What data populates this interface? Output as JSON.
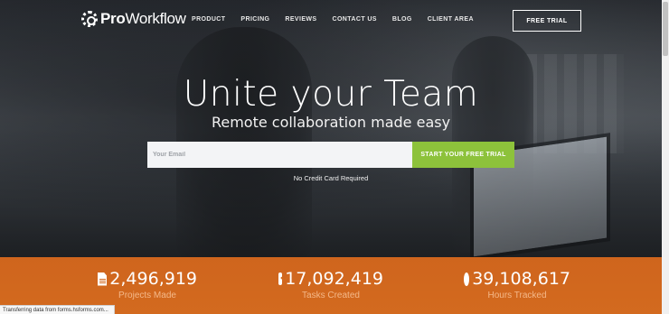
{
  "brand": {
    "logo_bold": "Pro",
    "logo_light": "Workflow"
  },
  "nav": {
    "items": [
      "PRODUCT",
      "PRICING",
      "REVIEWS",
      "CONTACT US",
      "BLOG",
      "CLIENT AREA"
    ],
    "cta": "FREE TRIAL"
  },
  "hero": {
    "title": "Unite your Team",
    "subtitle": "Remote collaboration made easy",
    "email_placeholder": "Your Email",
    "submit_label": "START YOUR FREE TRIAL",
    "note": "No Credit Card Required"
  },
  "stats": [
    {
      "icon": "document-icon",
      "value": "2,496,919",
      "label": "Projects Made"
    },
    {
      "icon": "checkbox-icon",
      "value": "17,092,419",
      "label": "Tasks Created"
    },
    {
      "icon": "clock-icon",
      "value": "39,108,617",
      "label": "Hours Tracked"
    }
  ],
  "status_bar": {
    "text": "Transferring data from forms.hsforms.com..."
  },
  "colors": {
    "accent_green": "#8dc23b",
    "stats_orange": "#d36a1f",
    "stat_label": "#f4b889"
  }
}
